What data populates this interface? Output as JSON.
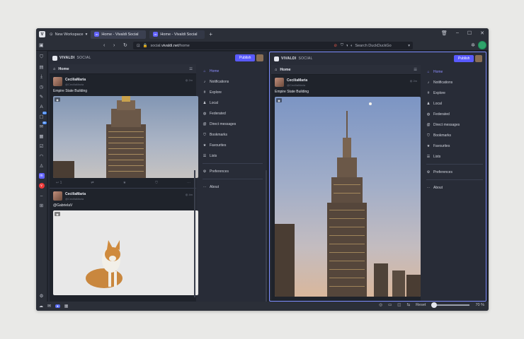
{
  "browser": {
    "workspace_label": "New Workspace",
    "tabs": [
      {
        "label": "Home - Vivaldi Social",
        "active": true
      },
      {
        "label": "Home - Vivaldi Social",
        "active": false
      }
    ],
    "new_tab_symbol": "+",
    "url_prefix": "social.",
    "url_domain": "vivaldi.net",
    "url_path": "/home",
    "search_placeholder": "Search DuckDuckGo",
    "accent": "#6364ff"
  },
  "sidebar_badges": [
    "13",
    "99"
  ],
  "statusbar": {
    "reset_label": "Reset",
    "zoom_label": "70 %",
    "zoom_level": 0
  },
  "mastodon": {
    "brand": "VIVALDI",
    "brand_suffix": "SOCIAL",
    "publish_label": "Publish",
    "column_title": "Home",
    "posts": [
      {
        "name": "CeciliaMaria",
        "handle": "@CeciliaMaria",
        "time": "2m",
        "text": "Empire State Building"
      },
      {
        "name": "CeciliaMaria",
        "handle": "@CeciliaMaria",
        "time": "4m",
        "text": "@GabrielaV"
      }
    ],
    "right_post": {
      "name": "CeciliaMaria",
      "handle": "@CeciliaMaria",
      "time": "2m",
      "text": "Empire State Building"
    },
    "action_reply_count": "1",
    "nav": [
      {
        "label": "Home",
        "icon": "home-icon"
      },
      {
        "label": "Notifications",
        "icon": "bell-icon"
      },
      {
        "label": "Explore",
        "icon": "hash-icon"
      },
      {
        "label": "Local",
        "icon": "users-icon"
      },
      {
        "label": "Federated",
        "icon": "globe-icon"
      },
      {
        "label": "Direct messages",
        "icon": "at-icon"
      },
      {
        "label": "Bookmarks",
        "icon": "bookmark-icon"
      },
      {
        "label": "Favourites",
        "icon": "star-icon"
      },
      {
        "label": "Lists",
        "icon": "list-icon"
      },
      {
        "label": "Preferences",
        "icon": "gear-icon"
      },
      {
        "label": "About",
        "icon": "ellipsis-icon"
      }
    ]
  }
}
